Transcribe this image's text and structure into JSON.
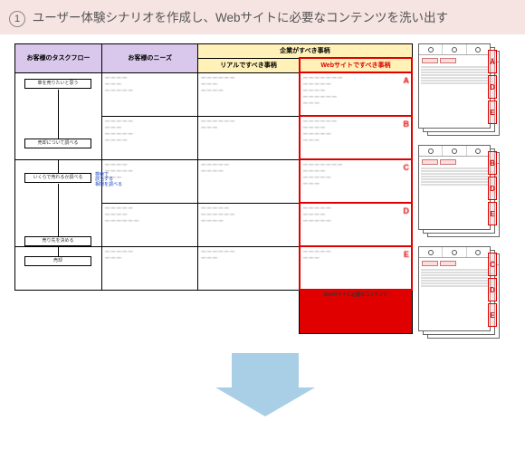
{
  "header": {
    "num": "1",
    "title": "ユーザー体験シナリオを作成し、Webサイトに必要なコンテンツを洗い出す"
  },
  "table": {
    "h_taskflow": "お客様のタスクフロー",
    "h_needs": "お客様のニーズ",
    "h_company": "企業がすべき事柄",
    "h_real": "リアルですべき事柄",
    "h_web": "Webサイトですべき事柄",
    "flow": {
      "box1": "車を売りたいと思う",
      "box2": "売却について調べる",
      "box3": "いくらで売れるか調べる",
      "note3a": "検索で",
      "note3b": "該当する",
      "note3c": "相場を調べる",
      "box4": "売り先を決める",
      "box5": "売却"
    },
    "labels": {
      "A": "A",
      "B": "B",
      "C": "C",
      "D": "D",
      "E": "E"
    },
    "footer_web": "Webサイトに必要なコンテンツ"
  },
  "side": {
    "stack1": [
      "A",
      "D",
      "E"
    ],
    "stack2": [
      "B",
      "D",
      "E"
    ],
    "stack3": [
      "C",
      "D",
      "E"
    ]
  }
}
